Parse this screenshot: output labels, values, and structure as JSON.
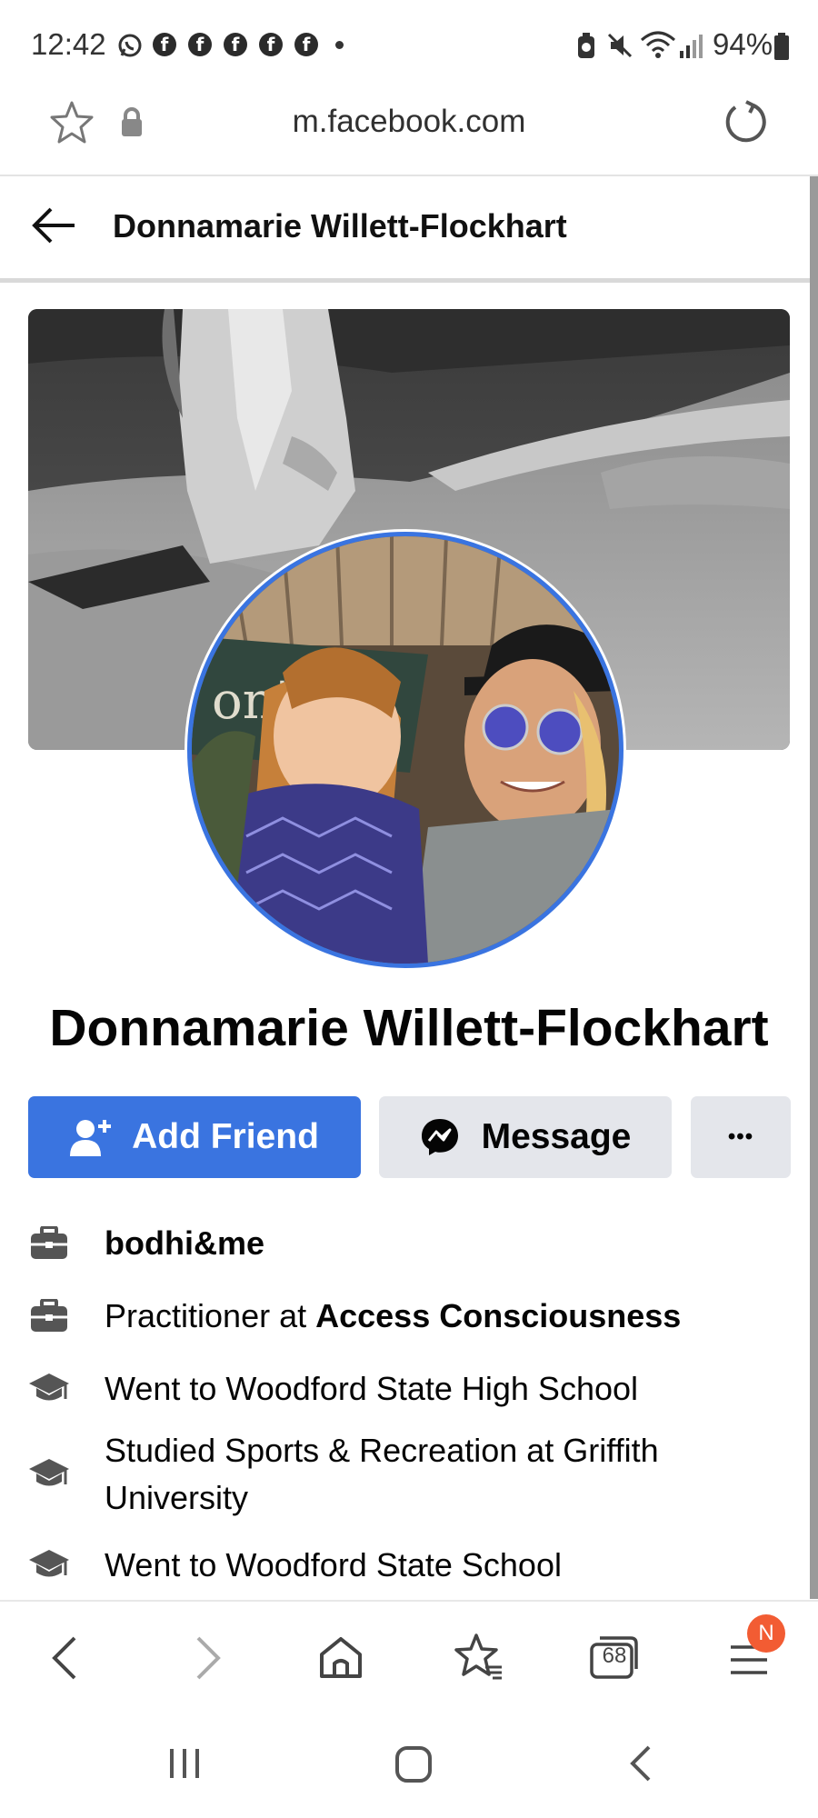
{
  "status_bar": {
    "time": "12:42",
    "notification_icons": [
      "whatsapp-icon",
      "facebook-icon",
      "facebook-icon",
      "facebook-icon",
      "facebook-icon",
      "facebook-icon"
    ],
    "battery_text": "94%"
  },
  "browser": {
    "url": "m.facebook.com",
    "tab_count": "68",
    "menu_badge": "N"
  },
  "header": {
    "title": "Donnamarie Willett-Flockhart"
  },
  "profile": {
    "name": "Donnamarie Willett-Flockhart",
    "cover_text_fragment": "on's",
    "actions": {
      "add_friend": "Add Friend",
      "message": "Message",
      "more": "•••"
    },
    "details": [
      {
        "icon": "briefcase-icon",
        "text": "bodhi&me"
      },
      {
        "icon": "briefcase-icon",
        "prefix": "Practitioner at ",
        "bold": "Access Consciousness"
      },
      {
        "icon": "graduation-cap-icon",
        "text": "Went to Woodford State High School"
      },
      {
        "icon": "graduation-cap-icon",
        "line1": "Studied Sports & Recreation at Griffith",
        "line2": "University"
      },
      {
        "icon": "graduation-cap-icon",
        "text": "Went to Woodford State School"
      }
    ]
  },
  "colors": {
    "brand_blue": "#3a74e0",
    "button_gray": "#e4e6eb",
    "badge_orange": "#f25c33"
  }
}
